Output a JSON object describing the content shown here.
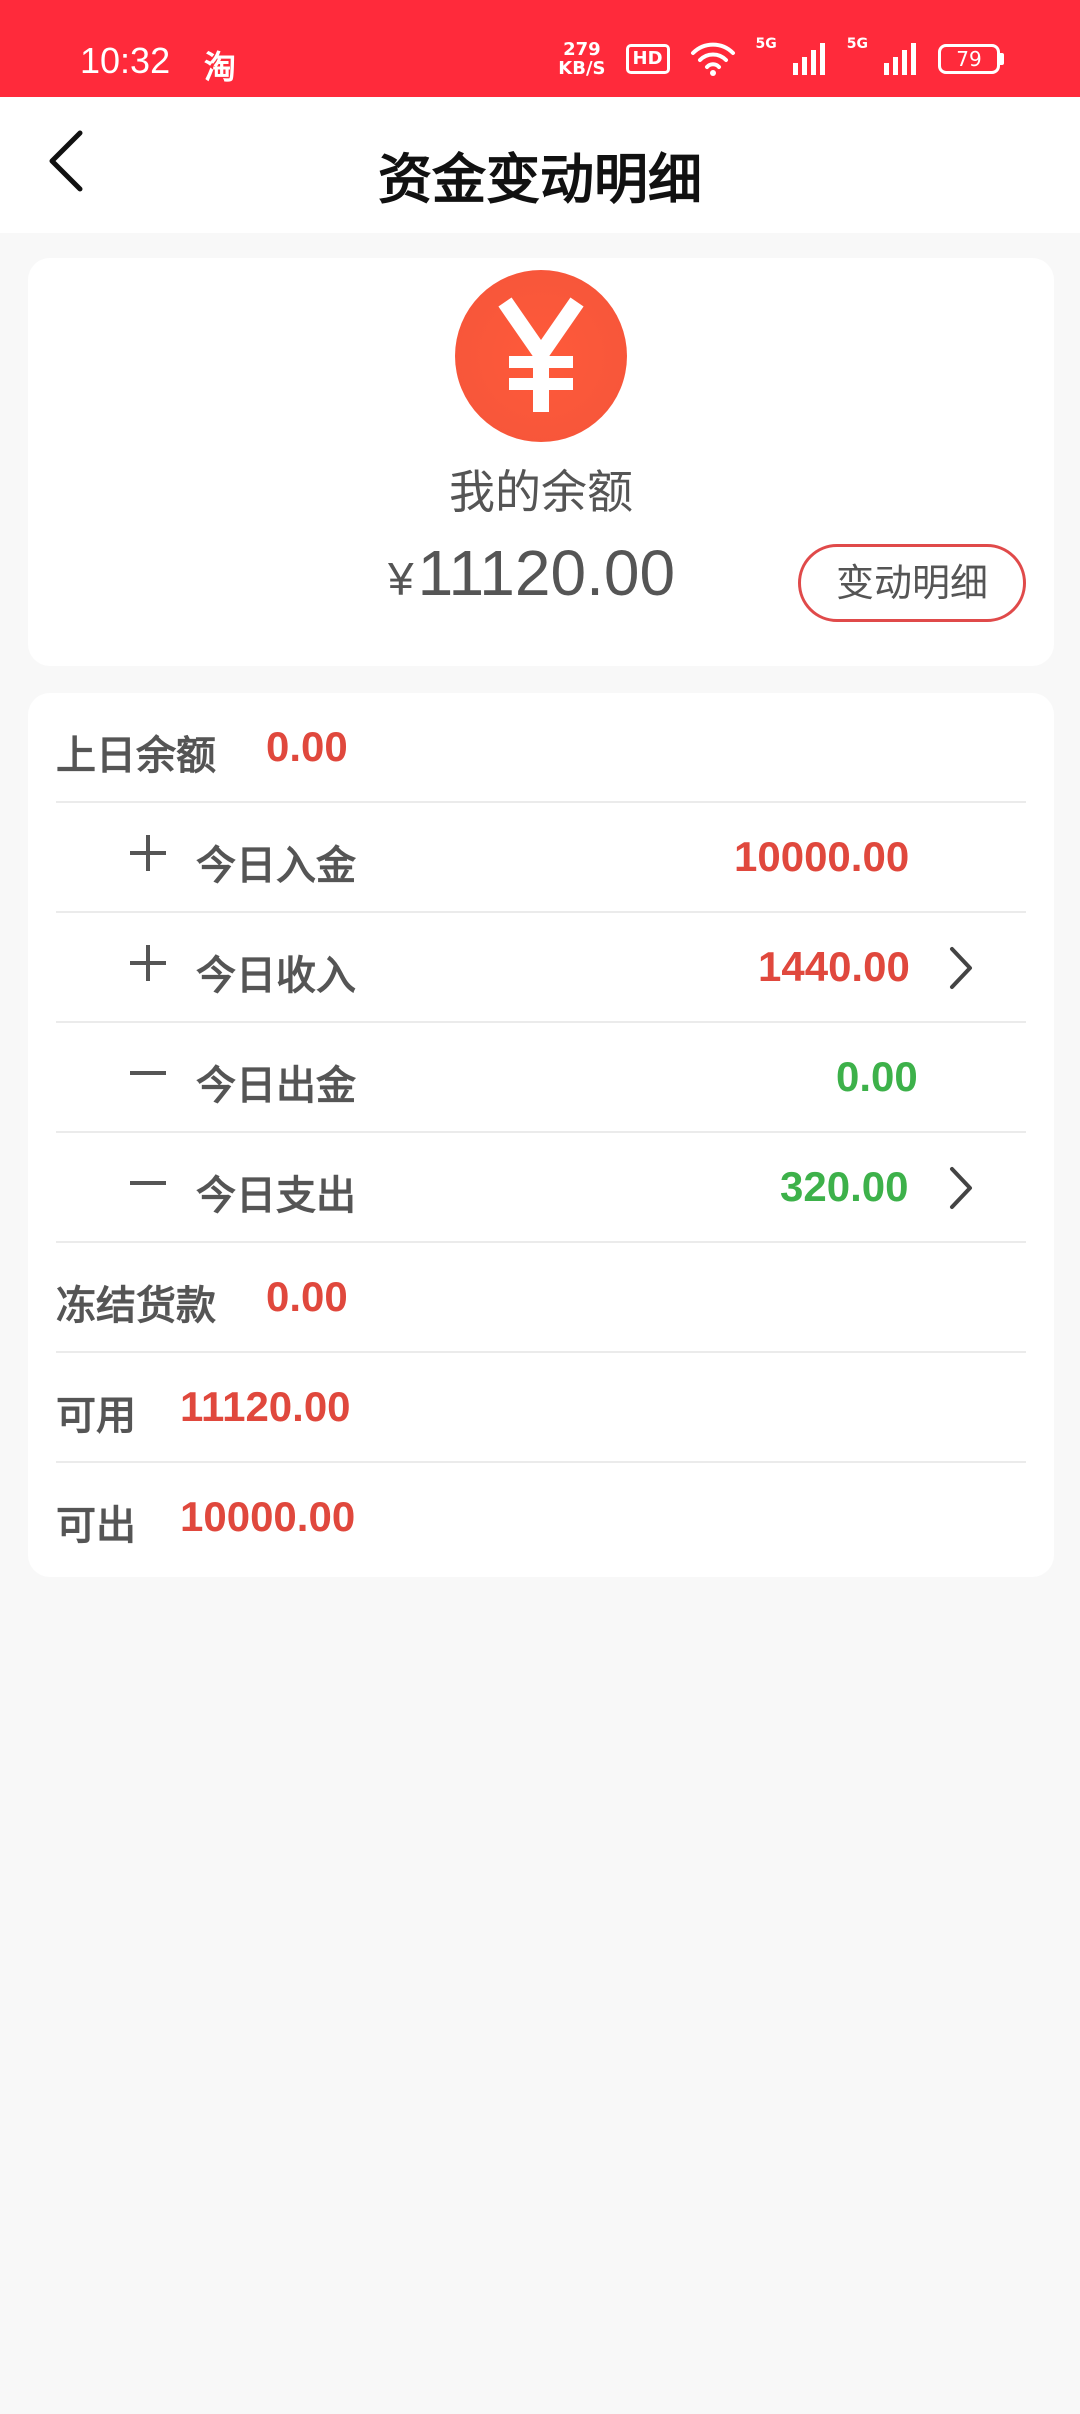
{
  "status_bar": {
    "time": "10:32",
    "app_glyph": "淘",
    "speed_value": "279",
    "speed_unit": "KB/S",
    "hd": "HD",
    "net1": "5G",
    "net2": "5G",
    "battery": "79"
  },
  "header": {
    "title": "资金变动明细",
    "back_icon": "chevron-left-icon"
  },
  "balance_card": {
    "icon": "yen-icon",
    "label": "我的余额",
    "currency": "¥",
    "amount": "11120.00",
    "detail_button": "变动明细"
  },
  "rows": [
    {
      "label": "上日余额",
      "value": "0.00",
      "color": "#e0483d"
    },
    {
      "sign": "plus",
      "label": "今日入金",
      "value": "10000.00",
      "color": "#e0483d",
      "chevron": false
    },
    {
      "sign": "plus",
      "label": "今日收入",
      "value": "1440.00",
      "color": "#e0483d",
      "chevron": true
    },
    {
      "sign": "minus",
      "label": "今日出金",
      "value": "0.00",
      "color": "#3db14a",
      "chevron": false
    },
    {
      "sign": "minus",
      "label": "今日支出",
      "value": "320.00",
      "color": "#3db14a",
      "chevron": true
    },
    {
      "label": "冻结货款",
      "value": "0.00",
      "color": "#e0483d"
    },
    {
      "label": "可用",
      "value": "11120.00",
      "color": "#e0483d"
    },
    {
      "label": "可出",
      "value": "10000.00",
      "color": "#e0483d"
    }
  ]
}
